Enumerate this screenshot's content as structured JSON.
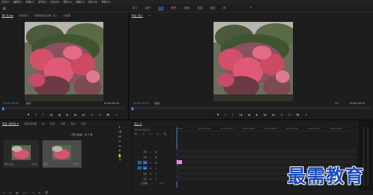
{
  "menu": [
    "文件(F)",
    "编辑(E)",
    "剪辑(C)",
    "序列(S)",
    "标记(M)",
    "图形(G)",
    "视图(V)",
    "窗口(W)",
    "帮助(H)"
  ],
  "workspace": {
    "tabs": [
      "学习",
      "组件",
      "编辑",
      "颜色",
      "效果",
      "音频",
      "图形",
      "库"
    ],
    "active_index": 2,
    "more": "»"
  },
  "source_panel": {
    "tabs": [
      "源: 花.jpg",
      "效果控件",
      "音频剪辑混合器: 花儿",
      "元数据"
    ],
    "timecode": "00;00;00;00",
    "fit": "适合",
    "duration_text": "00:00:05:00",
    "controls": [
      "▼",
      "{",
      "}",
      "|◀",
      "◀|",
      "▶",
      "|▶",
      "▶|",
      "⊡",
      "⊟",
      "📷",
      "+"
    ]
  },
  "program_panel": {
    "tabs": [
      "节目: 花儿",
      "≡"
    ],
    "timecode": "00;00;00;00",
    "fit": "适合",
    "ratio": "1/2",
    "duration_text": "00;00;05;00",
    "controls": [
      "▼",
      "{",
      "}",
      "|◀",
      "◀|",
      "▶",
      "|▶",
      "▶|",
      "⊡",
      "⊟",
      "📷",
      "+"
    ]
  },
  "project_panel": {
    "tabs": [
      "项目: 未命名 ≡",
      "媒体浏览器",
      "库",
      "信息",
      "效果",
      "标记",
      "历史"
    ],
    "items": [
      {
        "name": "花儿.jpg",
        "duration": "5;00"
      },
      {
        "name": "花儿",
        "duration": "5;00"
      }
    ],
    "count": "1 项已选择，共 2 项"
  },
  "timeline": {
    "tab": "花儿 ≡",
    "timecode": "00;00;00;00",
    "ruler": [
      "00;00",
      "00;00;16;00",
      "00;00;32;00",
      "00;00;48;00",
      "00;01;04;02",
      "00;01;20;02",
      "00;01;36;02",
      "00;01;52;02",
      "00;02;08;04",
      "00;02;24;04",
      "00;02;40;04"
    ],
    "video_tracks": [
      "V3",
      "V2",
      "V1"
    ],
    "audio_tracks": [
      "A1",
      "A2",
      "A3"
    ],
    "master_label": "主声道",
    "master_value": "0.0"
  },
  "watermark": "最需教育",
  "colors": {
    "accent": "#3f8ae8",
    "clip": "#d98cd9",
    "watermark": "#1f4db8"
  }
}
